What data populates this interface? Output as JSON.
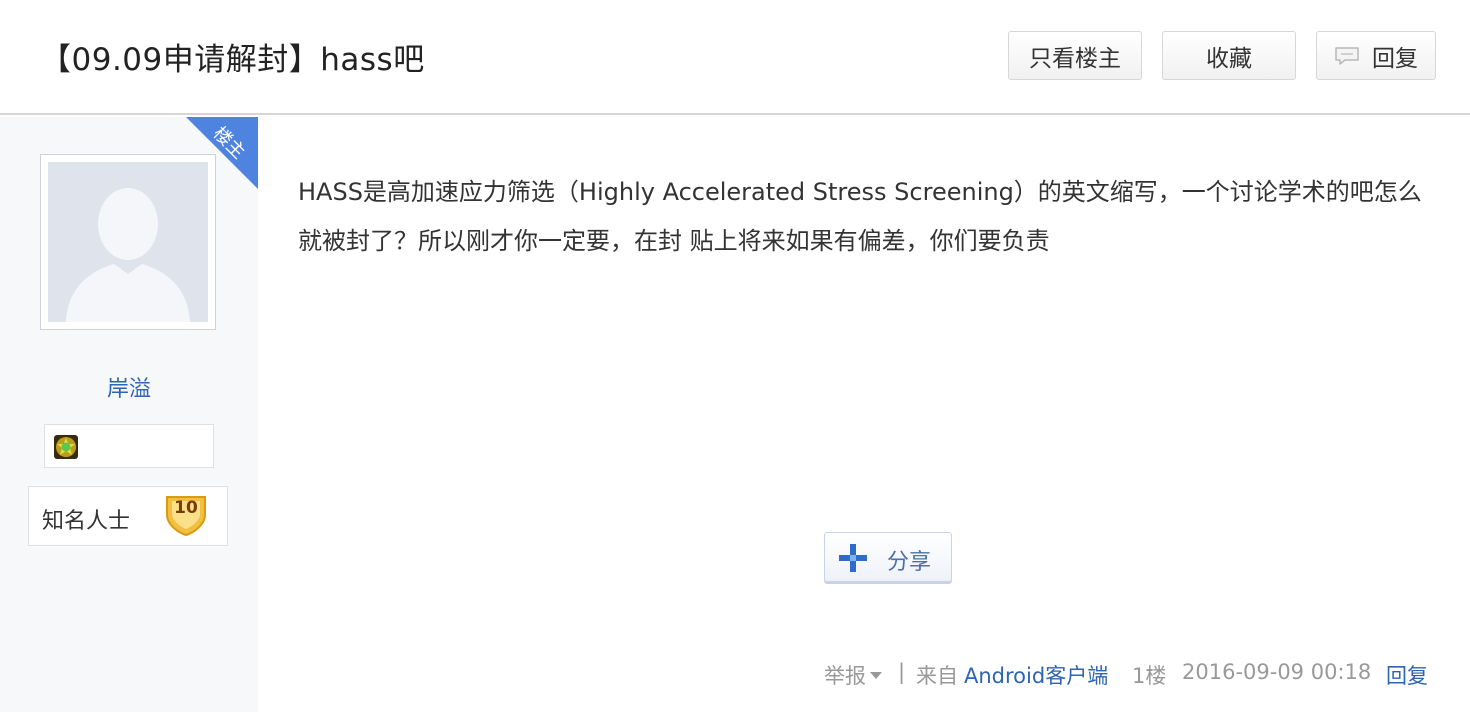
{
  "thread": {
    "title": "【09.09申请解封】hass吧"
  },
  "toolbar": {
    "only_op_label": "只看楼主",
    "favorite_label": "收藏",
    "reply_label": "回复"
  },
  "author": {
    "corner_tag": "楼主",
    "username": "岸溢",
    "level_title": "知名人士",
    "level_number": "10"
  },
  "post": {
    "content": "HASS是高加速应力筛选（Highly Accelerated Stress Screening）的英文缩写，一个讨论学术的吧怎么就被封了？所以刚才你一定要，在封 贴上将来如果有偏差，你们要负责",
    "share_label": "分享"
  },
  "footer": {
    "report_label": "举报",
    "separator": "|",
    "from_prefix": "来自",
    "platform": "Android客户端",
    "floor": "1楼",
    "timestamp": "2016-09-09 00:18",
    "reply_label": "回复"
  },
  "colors": {
    "link": "#2d64b3",
    "corner_tag_bg": "#4e83e0",
    "sidebar_bg": "#f7f8fa"
  },
  "icons": {
    "reply": "speech-bubble-icon",
    "badge": "green-gem-badge-icon",
    "level": "gold-shield-level-icon",
    "share": "blue-plus-share-icon"
  }
}
